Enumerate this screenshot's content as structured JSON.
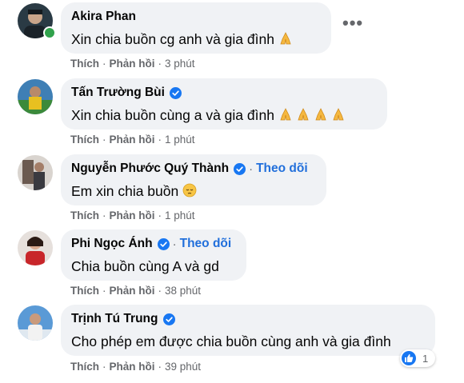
{
  "comments": [
    {
      "name": "Akira Phan",
      "verified": false,
      "follow": "",
      "text": "Xin chia buồn cg anh và gia đình",
      "emoji": "pray",
      "emoji_count": 1,
      "like_label": "Thích",
      "reply_label": "Phản hồi",
      "time": "3 phút",
      "online": true
    },
    {
      "name": "Tấn Trường Bùi",
      "verified": true,
      "follow": "",
      "text": "Xin chia buồn cùng a và gia đình",
      "emoji": "pray",
      "emoji_count": 4,
      "like_label": "Thích",
      "reply_label": "Phản hồi",
      "time": "1 phút"
    },
    {
      "name": "Nguyễn Phước Quý Thành",
      "verified": true,
      "follow": "Theo dõi",
      "text": "Em xin chia buồn",
      "emoji": "pensive",
      "emoji_count": 1,
      "like_label": "Thích",
      "reply_label": "Phản hồi",
      "time": "1 phút"
    },
    {
      "name": "Phi Ngọc Ánh",
      "verified": true,
      "follow": "Theo dõi",
      "text": "Chia buồn cùng A và gd",
      "emoji": "",
      "emoji_count": 0,
      "like_label": "Thích",
      "reply_label": "Phản hồi",
      "time": "38 phút"
    },
    {
      "name": "Trịnh Tú Trung",
      "verified": true,
      "follow": "",
      "text": "Cho phép em được chia buồn cùng anh và gia đình",
      "emoji": "",
      "emoji_count": 0,
      "like_label": "Thích",
      "reply_label": "Phản hồi",
      "time": "39 phút"
    }
  ],
  "reaction": {
    "icon": "like-icon",
    "count": "1"
  },
  "more_options": "•••",
  "colors": {
    "bubble": "#f0f2f5",
    "accent": "#216fdb",
    "verified": "#1877f2",
    "online": "#31a24c",
    "meta": "#65676b"
  }
}
